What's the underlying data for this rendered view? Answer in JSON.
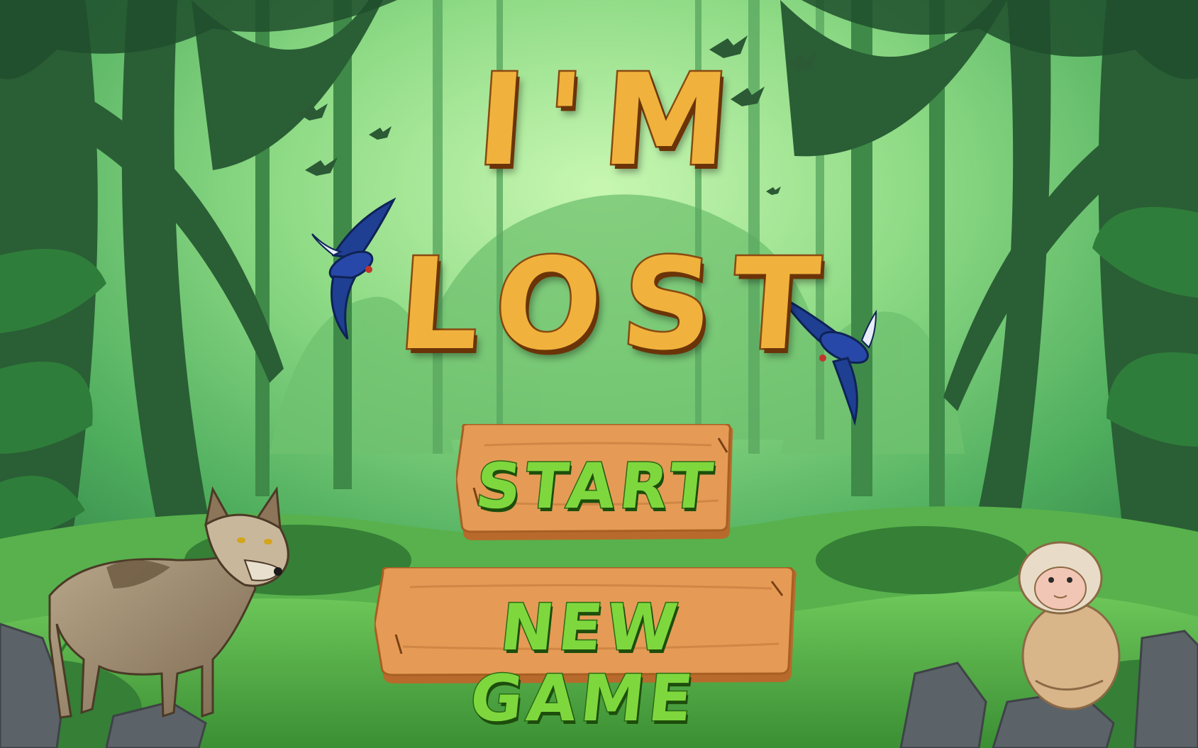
{
  "game": {
    "title_line_1": "I'M",
    "title_line_2": "LOST"
  },
  "menu": {
    "start_label": "START",
    "new_game_label": "NEW GAME"
  },
  "colors": {
    "title_fill": "#f0b23c",
    "title_outline": "#8a4a12",
    "plank_wood": "#e59b56",
    "label_green": "#7fd73e",
    "forest_light": "#b8f0a6",
    "forest_dark": "#1e4a2a"
  },
  "characters": [
    "wolf",
    "monkey",
    "blue-bird",
    "blue-bird",
    "bird-silhouettes"
  ]
}
